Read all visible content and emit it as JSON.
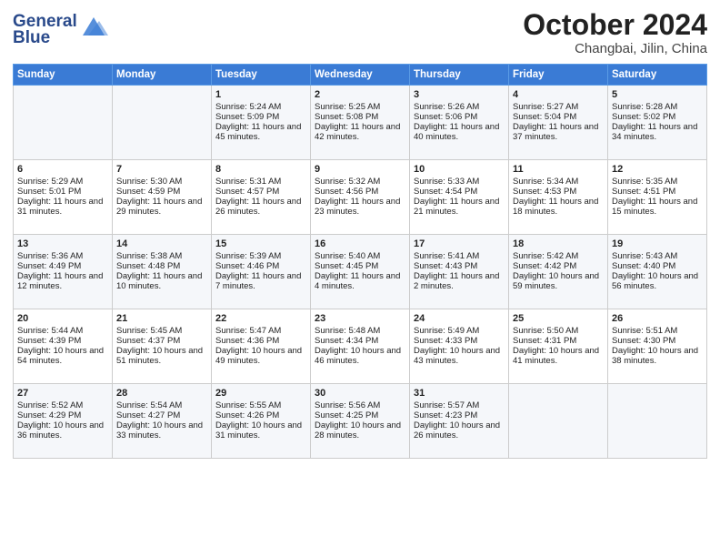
{
  "header": {
    "logo_line1": "General",
    "logo_line2": "Blue",
    "month": "October 2024",
    "location": "Changbai, Jilin, China"
  },
  "days_of_week": [
    "Sunday",
    "Monday",
    "Tuesday",
    "Wednesday",
    "Thursday",
    "Friday",
    "Saturday"
  ],
  "weeks": [
    [
      {
        "day": "",
        "data": ""
      },
      {
        "day": "",
        "data": ""
      },
      {
        "day": "1",
        "data": "Sunrise: 5:24 AM\nSunset: 5:09 PM\nDaylight: 11 hours and 45 minutes."
      },
      {
        "day": "2",
        "data": "Sunrise: 5:25 AM\nSunset: 5:08 PM\nDaylight: 11 hours and 42 minutes."
      },
      {
        "day": "3",
        "data": "Sunrise: 5:26 AM\nSunset: 5:06 PM\nDaylight: 11 hours and 40 minutes."
      },
      {
        "day": "4",
        "data": "Sunrise: 5:27 AM\nSunset: 5:04 PM\nDaylight: 11 hours and 37 minutes."
      },
      {
        "day": "5",
        "data": "Sunrise: 5:28 AM\nSunset: 5:02 PM\nDaylight: 11 hours and 34 minutes."
      }
    ],
    [
      {
        "day": "6",
        "data": "Sunrise: 5:29 AM\nSunset: 5:01 PM\nDaylight: 11 hours and 31 minutes."
      },
      {
        "day": "7",
        "data": "Sunrise: 5:30 AM\nSunset: 4:59 PM\nDaylight: 11 hours and 29 minutes."
      },
      {
        "day": "8",
        "data": "Sunrise: 5:31 AM\nSunset: 4:57 PM\nDaylight: 11 hours and 26 minutes."
      },
      {
        "day": "9",
        "data": "Sunrise: 5:32 AM\nSunset: 4:56 PM\nDaylight: 11 hours and 23 minutes."
      },
      {
        "day": "10",
        "data": "Sunrise: 5:33 AM\nSunset: 4:54 PM\nDaylight: 11 hours and 21 minutes."
      },
      {
        "day": "11",
        "data": "Sunrise: 5:34 AM\nSunset: 4:53 PM\nDaylight: 11 hours and 18 minutes."
      },
      {
        "day": "12",
        "data": "Sunrise: 5:35 AM\nSunset: 4:51 PM\nDaylight: 11 hours and 15 minutes."
      }
    ],
    [
      {
        "day": "13",
        "data": "Sunrise: 5:36 AM\nSunset: 4:49 PM\nDaylight: 11 hours and 12 minutes."
      },
      {
        "day": "14",
        "data": "Sunrise: 5:38 AM\nSunset: 4:48 PM\nDaylight: 11 hours and 10 minutes."
      },
      {
        "day": "15",
        "data": "Sunrise: 5:39 AM\nSunset: 4:46 PM\nDaylight: 11 hours and 7 minutes."
      },
      {
        "day": "16",
        "data": "Sunrise: 5:40 AM\nSunset: 4:45 PM\nDaylight: 11 hours and 4 minutes."
      },
      {
        "day": "17",
        "data": "Sunrise: 5:41 AM\nSunset: 4:43 PM\nDaylight: 11 hours and 2 minutes."
      },
      {
        "day": "18",
        "data": "Sunrise: 5:42 AM\nSunset: 4:42 PM\nDaylight: 10 hours and 59 minutes."
      },
      {
        "day": "19",
        "data": "Sunrise: 5:43 AM\nSunset: 4:40 PM\nDaylight: 10 hours and 56 minutes."
      }
    ],
    [
      {
        "day": "20",
        "data": "Sunrise: 5:44 AM\nSunset: 4:39 PM\nDaylight: 10 hours and 54 minutes."
      },
      {
        "day": "21",
        "data": "Sunrise: 5:45 AM\nSunset: 4:37 PM\nDaylight: 10 hours and 51 minutes."
      },
      {
        "day": "22",
        "data": "Sunrise: 5:47 AM\nSunset: 4:36 PM\nDaylight: 10 hours and 49 minutes."
      },
      {
        "day": "23",
        "data": "Sunrise: 5:48 AM\nSunset: 4:34 PM\nDaylight: 10 hours and 46 minutes."
      },
      {
        "day": "24",
        "data": "Sunrise: 5:49 AM\nSunset: 4:33 PM\nDaylight: 10 hours and 43 minutes."
      },
      {
        "day": "25",
        "data": "Sunrise: 5:50 AM\nSunset: 4:31 PM\nDaylight: 10 hours and 41 minutes."
      },
      {
        "day": "26",
        "data": "Sunrise: 5:51 AM\nSunset: 4:30 PM\nDaylight: 10 hours and 38 minutes."
      }
    ],
    [
      {
        "day": "27",
        "data": "Sunrise: 5:52 AM\nSunset: 4:29 PM\nDaylight: 10 hours and 36 minutes."
      },
      {
        "day": "28",
        "data": "Sunrise: 5:54 AM\nSunset: 4:27 PM\nDaylight: 10 hours and 33 minutes."
      },
      {
        "day": "29",
        "data": "Sunrise: 5:55 AM\nSunset: 4:26 PM\nDaylight: 10 hours and 31 minutes."
      },
      {
        "day": "30",
        "data": "Sunrise: 5:56 AM\nSunset: 4:25 PM\nDaylight: 10 hours and 28 minutes."
      },
      {
        "day": "31",
        "data": "Sunrise: 5:57 AM\nSunset: 4:23 PM\nDaylight: 10 hours and 26 minutes."
      },
      {
        "day": "",
        "data": ""
      },
      {
        "day": "",
        "data": ""
      }
    ]
  ]
}
